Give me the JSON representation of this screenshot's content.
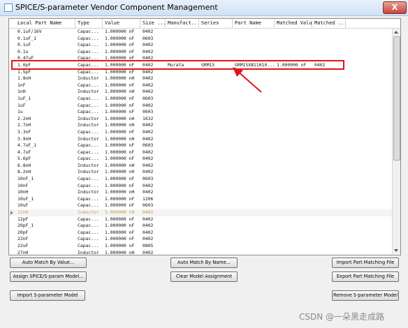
{
  "window": {
    "title": "SPICE/S-parameter Vendor Component Management",
    "close_label": "X"
  },
  "table": {
    "columns": [
      "Local Part Name",
      "Type",
      "Value",
      "Size ...",
      "Manufact...",
      "Series",
      "Part Name",
      "Matched Value",
      "Matched ..."
    ],
    "rows": [
      {
        "name": "0.1uF/16V",
        "type": "Capac...",
        "value": "1.000000 nF",
        "size": "0402",
        "manufacturer": "",
        "series": "",
        "part": "",
        "mvalue": "",
        "msize": ""
      },
      {
        "name": "0.1uF_1",
        "type": "Capac...",
        "value": "1.000000 nF",
        "size": "0603",
        "manufacturer": "",
        "series": "",
        "part": "",
        "mvalue": "",
        "msize": ""
      },
      {
        "name": "0.1uF",
        "type": "Capac...",
        "value": "1.000000 nF",
        "size": "0402",
        "manufacturer": "",
        "series": "",
        "part": "",
        "mvalue": "",
        "msize": ""
      },
      {
        "name": "0.1u",
        "type": "Capac...",
        "value": "1.000000 nF",
        "size": "0402",
        "manufacturer": "",
        "series": "",
        "part": "",
        "mvalue": "",
        "msize": ""
      },
      {
        "name": "0.47uF",
        "type": "Capac...",
        "value": "1.000000 nF",
        "size": "0402",
        "manufacturer": "",
        "series": "",
        "part": "",
        "mvalue": "",
        "msize": ""
      },
      {
        "name": "1.0pF",
        "type": "Capac...",
        "value": "1.000000 nF",
        "size": "0402",
        "manufacturer": "Murata",
        "series": "GRM15",
        "part": "GRM15XB11H10...",
        "mvalue": "1.000000 nF",
        "msize": "0402"
      },
      {
        "name": "1.5pF",
        "type": "Capac...",
        "value": "1.000000 nF",
        "size": "0402",
        "manufacturer": "",
        "series": "",
        "part": "",
        "mvalue": "",
        "msize": ""
      },
      {
        "name": "1.8nH",
        "type": "Inductor",
        "value": "1.000000 nH",
        "size": "0402",
        "manufacturer": "",
        "series": "",
        "part": "",
        "mvalue": "",
        "msize": ""
      },
      {
        "name": "1nF",
        "type": "Capac...",
        "value": "1.000000 nF",
        "size": "0402",
        "manufacturer": "",
        "series": "",
        "part": "",
        "mvalue": "",
        "msize": ""
      },
      {
        "name": "1nH",
        "type": "Inductor",
        "value": "1.000000 nH",
        "size": "0402",
        "manufacturer": "",
        "series": "",
        "part": "",
        "mvalue": "",
        "msize": ""
      },
      {
        "name": "1uF_1",
        "type": "Capac...",
        "value": "1.000000 nF",
        "size": "0603",
        "manufacturer": "",
        "series": "",
        "part": "",
        "mvalue": "",
        "msize": ""
      },
      {
        "name": "1uF",
        "type": "Capac...",
        "value": "1.000000 nF",
        "size": "0402",
        "manufacturer": "",
        "series": "",
        "part": "",
        "mvalue": "",
        "msize": ""
      },
      {
        "name": "1u",
        "type": "Capac...",
        "value": "1.000000 nF",
        "size": "0603",
        "manufacturer": "",
        "series": "",
        "part": "",
        "mvalue": "",
        "msize": ""
      },
      {
        "name": "2.2nH",
        "type": "Inductor",
        "value": "1.000000 nH",
        "size": "1632",
        "manufacturer": "",
        "series": "",
        "part": "",
        "mvalue": "",
        "msize": ""
      },
      {
        "name": "2.7nH",
        "type": "Inductor",
        "value": "1.000000 nH",
        "size": "0402",
        "manufacturer": "",
        "series": "",
        "part": "",
        "mvalue": "",
        "msize": ""
      },
      {
        "name": "3.3nF",
        "type": "Capac...",
        "value": "1.000000 nF",
        "size": "0402",
        "manufacturer": "",
        "series": "",
        "part": "",
        "mvalue": "",
        "msize": ""
      },
      {
        "name": "3.9nH",
        "type": "Inductor",
        "value": "1.000000 nH",
        "size": "0402",
        "manufacturer": "",
        "series": "",
        "part": "",
        "mvalue": "",
        "msize": ""
      },
      {
        "name": "4.7uF_1",
        "type": "Capac...",
        "value": "1.000000 nF",
        "size": "0603",
        "manufacturer": "",
        "series": "",
        "part": "",
        "mvalue": "",
        "msize": ""
      },
      {
        "name": "4.7uF",
        "type": "Capac...",
        "value": "1.000000 nF",
        "size": "0402",
        "manufacturer": "",
        "series": "",
        "part": "",
        "mvalue": "",
        "msize": ""
      },
      {
        "name": "5.6pF",
        "type": "Capac...",
        "value": "1.000000 nF",
        "size": "0402",
        "manufacturer": "",
        "series": "",
        "part": "",
        "mvalue": "",
        "msize": ""
      },
      {
        "name": "6.8nH",
        "type": "Inductor",
        "value": "1.000000 nH",
        "size": "0402",
        "manufacturer": "",
        "series": "",
        "part": "",
        "mvalue": "",
        "msize": ""
      },
      {
        "name": "8.2nH",
        "type": "Inductor",
        "value": "1.000000 nH",
        "size": "0402",
        "manufacturer": "",
        "series": "",
        "part": "",
        "mvalue": "",
        "msize": ""
      },
      {
        "name": "10nF_1",
        "type": "Capac...",
        "value": "1.000000 nF",
        "size": "0603",
        "manufacturer": "",
        "series": "",
        "part": "",
        "mvalue": "",
        "msize": ""
      },
      {
        "name": "10nF",
        "type": "Capac...",
        "value": "1.000000 nF",
        "size": "0402",
        "manufacturer": "",
        "series": "",
        "part": "",
        "mvalue": "",
        "msize": ""
      },
      {
        "name": "10nH",
        "type": "Inductor",
        "value": "1.000000 nH",
        "size": "0402",
        "manufacturer": "",
        "series": "",
        "part": "",
        "mvalue": "",
        "msize": ""
      },
      {
        "name": "10uF_1",
        "type": "Capac...",
        "value": "1.000000 nF",
        "size": "1206",
        "manufacturer": "",
        "series": "",
        "part": "",
        "mvalue": "",
        "msize": ""
      },
      {
        "name": "10uF",
        "type": "Capac...",
        "value": "1.000000 nF",
        "size": "0603",
        "manufacturer": "",
        "series": "",
        "part": "",
        "mvalue": "",
        "msize": ""
      },
      {
        "name": "12nH",
        "type": "Inductor",
        "value": "1.000000 nH",
        "size": "0402",
        "manufacturer": "",
        "series": "",
        "part": "",
        "mvalue": "",
        "msize": ""
      },
      {
        "name": "12pF",
        "type": "Capac...",
        "value": "1.000000 nF",
        "size": "0402",
        "manufacturer": "",
        "series": "",
        "part": "",
        "mvalue": "",
        "msize": ""
      },
      {
        "name": "20pF_1",
        "type": "Capac...",
        "value": "1.000000 nF",
        "size": "0402",
        "manufacturer": "",
        "series": "",
        "part": "",
        "mvalue": "",
        "msize": ""
      },
      {
        "name": "20pF",
        "type": "Capac...",
        "value": "1.000000 nF",
        "size": "0402",
        "manufacturer": "",
        "series": "",
        "part": "",
        "mvalue": "",
        "msize": ""
      },
      {
        "name": "22nF",
        "type": "Capac...",
        "value": "1.000000 nF",
        "size": "0402",
        "manufacturer": "",
        "series": "",
        "part": "",
        "mvalue": "",
        "msize": ""
      },
      {
        "name": "22uF",
        "type": "Capac...",
        "value": "1.000000 nF",
        "size": "0805",
        "manufacturer": "",
        "series": "",
        "part": "",
        "mvalue": "",
        "msize": ""
      },
      {
        "name": "27nH",
        "type": "Inductor",
        "value": "1.000000 nH",
        "size": "0402",
        "manufacturer": "",
        "series": "",
        "part": "",
        "mvalue": "",
        "msize": ""
      }
    ],
    "highlighted_row_index": 5,
    "current_row_index": 27
  },
  "buttons": {
    "auto_match_value": "Auto Match By Value...",
    "auto_match_name": "Auto Match By Name...",
    "import_matching": "Import Part Matching File",
    "assign_model": "Assign SPICE/S-param Model...",
    "clear_model": "Clear Model Assignment",
    "export_matching": "Export Part Matching File",
    "import_sparam": "Import S-parameter Model",
    "remove_sparam": "Remove S-parameter Model"
  },
  "watermark": "CSDN @一朵黑走成路",
  "colors": {
    "annotation": "#e0141b",
    "current_row_text": "#c49a4a"
  }
}
